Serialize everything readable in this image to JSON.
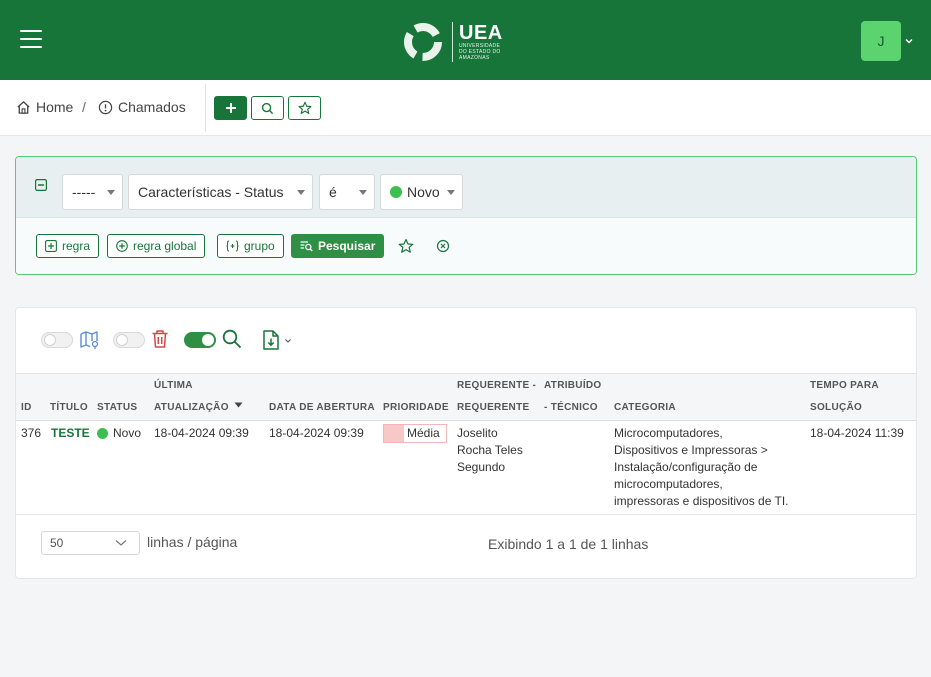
{
  "header": {
    "logo_title": "UEA",
    "logo_subtitle_lines": [
      "UNIVERSIDADE",
      "DO ESTADO DO",
      "AMAZONAS"
    ],
    "avatar_initial": "J",
    "brand_color": "#17753a"
  },
  "breadcrumb": {
    "home": "Home",
    "separator": "/",
    "current": "Chamados"
  },
  "filter": {
    "logic": "-----",
    "field": "Características - Status",
    "operator": "é",
    "value": "Novo",
    "value_color": "#3cbf4f",
    "buttons": {
      "regra": "regra",
      "regra_global": "regra global",
      "grupo": "grupo",
      "pesquisar": "Pesquisar"
    }
  },
  "table": {
    "columns": [
      {
        "line1": "",
        "line2": "ID"
      },
      {
        "line1": "",
        "line2": "TÍTULO"
      },
      {
        "line1": "",
        "line2": "STATUS"
      },
      {
        "line1": "ÚLTIMA",
        "line2": "ATUALIZAÇÃO"
      },
      {
        "line1": "",
        "line2": "DATA DE ABERTURA"
      },
      {
        "line1": "",
        "line2": "PRIORIDADE"
      },
      {
        "line1": "REQUERENTE -",
        "line2": "REQUERENTE"
      },
      {
        "line1": "ATRIBUÍDO",
        "line2": "- TÉCNICO"
      },
      {
        "line1": "",
        "line2": "CATEGORIA"
      },
      {
        "line1": "TEMPO PARA",
        "line2": "SOLUÇÃO"
      }
    ],
    "rows": [
      {
        "id": "376",
        "titulo": "TESTE",
        "status": "Novo",
        "status_color": "#3cbf4f",
        "ultima_atualizacao": "18-04-2024 09:39",
        "data_abertura": "18-04-2024 09:39",
        "prioridade": "Média",
        "prioridade_color": "#f8c7c7",
        "requerente_lines": [
          "Joselito",
          "Rocha Teles",
          "Segundo"
        ],
        "tecnico": "",
        "categoria_lines": [
          "Microcomputadores,",
          "Dispositivos e Impressoras >",
          "Instalação/configuração de",
          "microcomputadores,",
          "impressoras e dispositivos de TI."
        ],
        "tempo_solucao": "18-04-2024 11:39"
      }
    ]
  },
  "pager": {
    "per_page": "50",
    "per_page_label": "linhas / página",
    "info": "Exibindo 1 a 1 de 1 linhas"
  }
}
